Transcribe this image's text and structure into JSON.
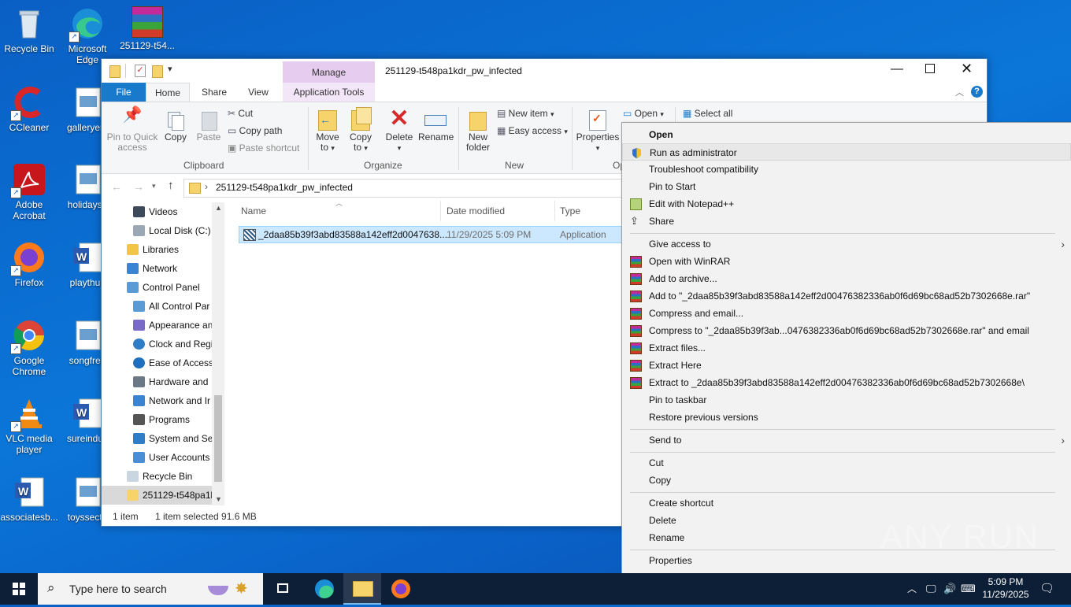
{
  "desktop": {
    "icons": [
      {
        "label": "Recycle Bin"
      },
      {
        "label": "Microsoft Edge"
      },
      {
        "label": "251129-t54..."
      },
      {
        "label": "CCleaner"
      },
      {
        "label": "galleryem"
      },
      {
        "label": "Adobe Acrobat"
      },
      {
        "label": "holidayse"
      },
      {
        "label": "Firefox"
      },
      {
        "label": "playthus"
      },
      {
        "label": "Google Chrome"
      },
      {
        "label": "songfren"
      },
      {
        "label": "VLC media player"
      },
      {
        "label": "sureindus"
      },
      {
        "label": "associatesb..."
      },
      {
        "label": "toyssecto"
      }
    ]
  },
  "window": {
    "title": "251129-t548pa1kdr_pw_infected",
    "manage_label": "Manage",
    "tabs": [
      {
        "label": "File"
      },
      {
        "label": "Home"
      },
      {
        "label": "Share"
      },
      {
        "label": "View"
      },
      {
        "label": "Application Tools"
      }
    ],
    "ribbon": {
      "pin_label": "Pin to Quick access",
      "copy_label": "Copy",
      "paste_label": "Paste",
      "cut_label": "Cut",
      "copy_path_label": "Copy path",
      "paste_shortcut_label": "Paste shortcut",
      "clipboard_group": "Clipboard",
      "move_to_label": "Move to",
      "copy_to_label": "Copy to",
      "delete_label": "Delete",
      "rename_label": "Rename",
      "organize_group": "Organize",
      "new_folder_label": "New folder",
      "new_item_label": "New item",
      "easy_access_label": "Easy access",
      "new_group": "New",
      "properties_label": "Properties",
      "open_group": "Op",
      "open_label": "Open",
      "select_all_label": "Select all"
    },
    "address": {
      "path": "251129-t548pa1kdr_pw_infected"
    },
    "nav": {
      "items": [
        {
          "label": "Videos"
        },
        {
          "label": "Local Disk (C:)"
        },
        {
          "label": "Libraries"
        },
        {
          "label": "Network"
        },
        {
          "label": "Control Panel"
        },
        {
          "label": "All Control Par"
        },
        {
          "label": "Appearance an"
        },
        {
          "label": "Clock and Regi"
        },
        {
          "label": "Ease of Access"
        },
        {
          "label": "Hardware and"
        },
        {
          "label": "Network and Ir"
        },
        {
          "label": "Programs"
        },
        {
          "label": "System and Se"
        },
        {
          "label": "User Accounts"
        },
        {
          "label": "Recycle Bin"
        },
        {
          "label": "251129-t548pa1k"
        }
      ]
    },
    "columns": {
      "name": "Name",
      "date": "Date modified",
      "type": "Type"
    },
    "file": {
      "name": "_2daa85b39f3abd83588a142eff2d0047638...",
      "date": "11/29/2025 5:09 PM",
      "type": "Application"
    },
    "status": {
      "count": "1 item",
      "selected": "1 item selected  91.6 MB"
    }
  },
  "context_menu": {
    "items": [
      {
        "label": "Open"
      },
      {
        "label": "Run as administrator"
      },
      {
        "label": "Troubleshoot compatibility"
      },
      {
        "label": "Pin to Start"
      },
      {
        "label": "Edit with Notepad++"
      },
      {
        "label": "Share"
      },
      {
        "label": "Give access to"
      },
      {
        "label": "Open with WinRAR"
      },
      {
        "label": "Add to archive..."
      },
      {
        "label": "Add to \"_2daa85b39f3abd83588a142eff2d00476382336ab0f6d69bc68ad52b7302668e.rar\""
      },
      {
        "label": "Compress and email..."
      },
      {
        "label": "Compress to \"_2daa85b39f3ab...0476382336ab0f6d69bc68ad52b7302668e.rar\" and email"
      },
      {
        "label": "Extract files..."
      },
      {
        "label": "Extract Here"
      },
      {
        "label": "Extract to _2daa85b39f3abd83588a142eff2d00476382336ab0f6d69bc68ad52b7302668e\\"
      },
      {
        "label": "Pin to taskbar"
      },
      {
        "label": "Restore previous versions"
      },
      {
        "label": "Send to"
      },
      {
        "label": "Cut"
      },
      {
        "label": "Copy"
      },
      {
        "label": "Create shortcut"
      },
      {
        "label": "Delete"
      },
      {
        "label": "Rename"
      },
      {
        "label": "Properties"
      }
    ]
  },
  "taskbar": {
    "search_placeholder": "Type here to search",
    "time": "5:09 PM",
    "date": "11/29/2025"
  },
  "watermark": "ANY RUN",
  "colors": {
    "accent": "#0078d7",
    "file_tab": "#1979ca",
    "manage": "#e6cdf0",
    "selection": "#cce8ff"
  }
}
